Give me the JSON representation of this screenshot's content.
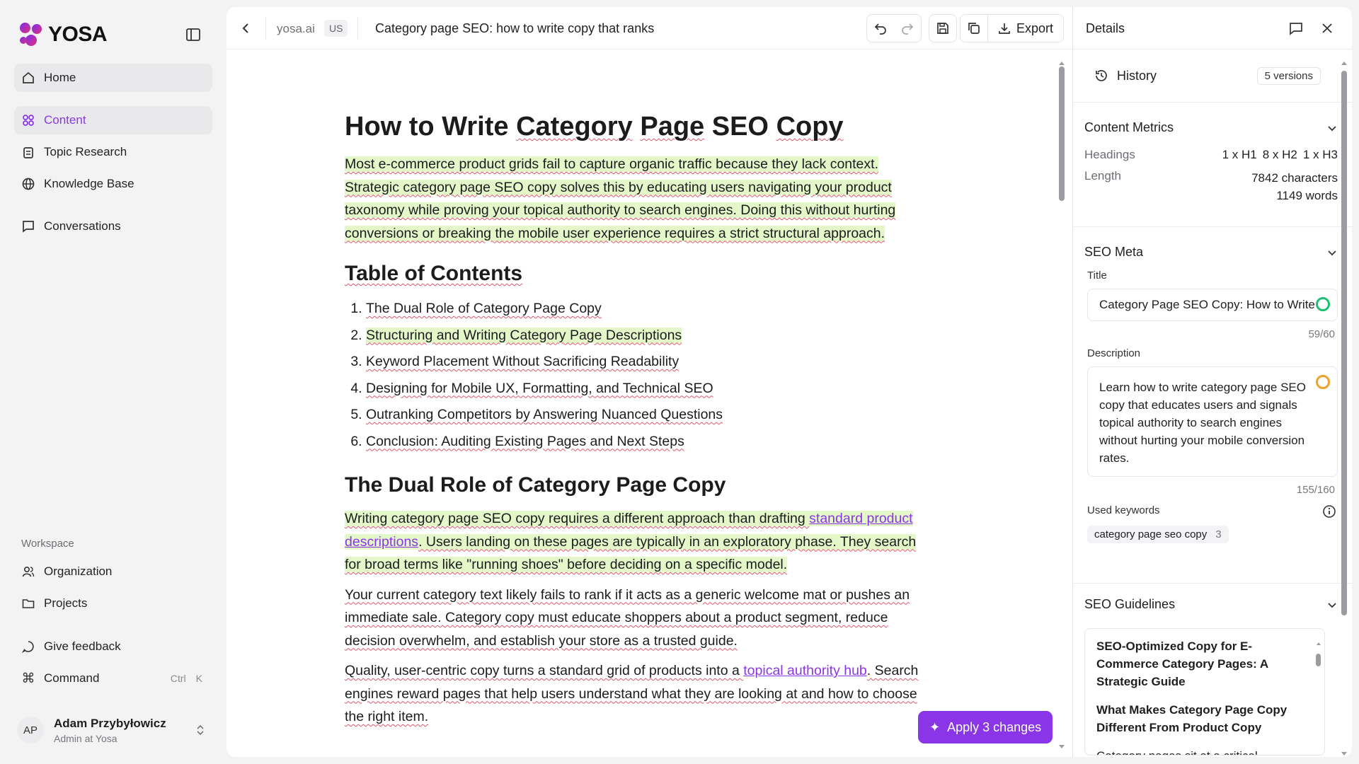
{
  "brand": {
    "name": "YOSA"
  },
  "sidebar": {
    "nav": [
      {
        "label": "Home",
        "icon": "home-icon"
      },
      {
        "label": "Content",
        "icon": "content-icon"
      },
      {
        "label": "Topic Research",
        "icon": "clipboard-icon"
      },
      {
        "label": "Knowledge Base",
        "icon": "globe-icon"
      },
      {
        "label": "Conversations",
        "icon": "chat-icon"
      }
    ],
    "workspace_label": "Workspace",
    "workspace": [
      {
        "label": "Organization",
        "icon": "users-icon"
      },
      {
        "label": "Projects",
        "icon": "folder-icon"
      }
    ],
    "feedback": "Give feedback",
    "command": {
      "label": "Command",
      "keys": [
        "Ctrl",
        "K"
      ]
    },
    "user": {
      "initials": "AP",
      "name": "Adam Przybyłowicz",
      "role": "Admin at Yosa"
    }
  },
  "toolbar": {
    "site": "yosa.ai",
    "region": "US",
    "title": "Category page SEO: how to write copy that ranks",
    "export": "Export"
  },
  "article": {
    "h1": [
      "How to Write ",
      "Category",
      " ",
      "Page",
      " SEO ",
      "Copy"
    ],
    "intro": "Most e-commerce product grids fail to capture organic traffic because they lack context. Strategic category page SEO copy solves this by educating users navigating your product taxonomy while proving your topical authority to search engines. Doing this without hurting conversions or breaking the mobile user experience requires a strict structural approach.",
    "toc_heading": "Table of Contents",
    "toc": [
      "The Dual Role of Category Page Copy",
      "Structuring and Writing Category Page Descriptions",
      "Keyword Placement Without Sacrificing Readability",
      "Designing for Mobile UX, Formatting, and Technical SEO",
      "Outranking Competitors by Answering Nuanced Questions",
      "Conclusion: Auditing Existing Pages and Next Steps"
    ],
    "h2_dual": "The Dual Role of Category Page Copy",
    "p1_a": "Writing category page SEO copy requires a different approach than drafting ",
    "p1_link": "standard product descriptions",
    "p1_b": ". Users landing on these pages are typically in an exploratory phase. They search for broad terms like \"running shoes\" before deciding on a specific model.",
    "p2": "Your current category text likely fails to rank if it acts as a generic welcome mat or pushes an immediate sale. Category copy must educate shoppers about a product segment, reduce decision overwhelm, and establish your store as a trusted guide.",
    "p3_a": "Quality, user-centric copy turns a standard grid of products into a ",
    "p3_link": "topical authority hub",
    "p3_b": ". Search engines reward pages that help users understand what they are looking at and how to choose the right item."
  },
  "apply_button": "Apply 3 changes",
  "details": {
    "title": "Details",
    "history": {
      "label": "History",
      "versions": "5 versions"
    },
    "metrics": {
      "title": "Content Metrics",
      "headings_label": "Headings",
      "h1": "1 x H1",
      "h2": "8 x H2",
      "h3": "1 x H3",
      "length_label": "Length",
      "characters": "7842 characters",
      "words": "1149 words"
    },
    "seo_meta": {
      "title": "SEO Meta",
      "title_label": "Title",
      "title_value": "Category Page SEO Copy: How to Write",
      "title_count": "59/60",
      "description_label": "Description",
      "description_value": "Learn how to write category page SEO copy that educates users and signals topical authority to search engines without hurting your mobile conversion rates.",
      "description_count": "155/160",
      "keywords_label": "Used keywords",
      "keyword": "category page seo copy",
      "keyword_count": "3"
    },
    "guidelines": {
      "title": "SEO Guidelines",
      "g1": "SEO-Optimized Copy for E-Commerce Category Pages: A Strategic Guide",
      "g2": "What Makes Category Page Copy Different From Product Copy",
      "g3": "Category pages sit at a critical"
    }
  },
  "colors": {
    "accent": "#8a36e8",
    "highlight": "#e3f7c9",
    "ok": "#1fbf73",
    "warn": "#f0a12b"
  }
}
